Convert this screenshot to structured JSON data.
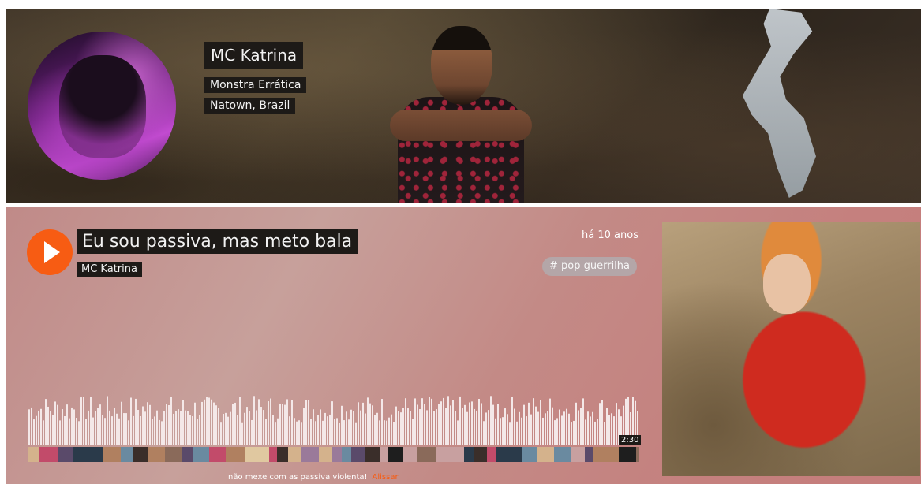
{
  "profile": {
    "name": "MC Katrina",
    "subtitle": "Monstra Errática",
    "location": "Natown, Brazil"
  },
  "track": {
    "title": "Eu sou passiva, mas meto bala",
    "artist": "MC Katrina",
    "posted": "há 10 anos",
    "genre_tag": "# pop guerrilha",
    "duration": "2:30",
    "comment_text": "não mexe com as passiva violenta!",
    "comment_author": "Alissar"
  },
  "colors": {
    "accent": "#f75c13",
    "label_bg": "#1d1a17",
    "tag_bg": "#b4a6a8"
  },
  "icons": {
    "play": "play-icon"
  }
}
